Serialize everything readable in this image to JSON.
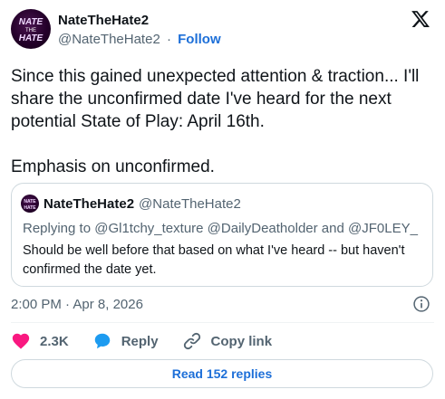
{
  "author": {
    "display_name": "NateTheHate2",
    "handle": "@NateTheHate2",
    "separator": "·",
    "follow_label": "Follow",
    "avatar_text": "NATE THE HATE"
  },
  "tweet": {
    "text": "Since this gained unexpected attention & traction... I'll share the unconfirmed date I've heard for the next potential State of Play: April 16th.\n\nEmphasis on unconfirmed."
  },
  "quote": {
    "display_name": "NateTheHate2",
    "handle": "@NateTheHate2",
    "replying_prefix": "Replying to",
    "mentions": [
      "@Gl1tchy_texture",
      "@DailyDeatholder",
      "@JF0LEY_"
    ],
    "and_word": "and",
    "body": "Should be well before that based on what I've heard -- but haven't confirmed the date yet."
  },
  "meta": {
    "time": "2:00 PM",
    "separator": "·",
    "date": "Apr 8, 2026"
  },
  "actions": {
    "like_count": "2.3K",
    "reply_label": "Reply",
    "copy_label": "Copy link"
  },
  "read_replies_label": "Read 152 replies",
  "colors": {
    "like": "#f91880",
    "reply": "#1d9bf0",
    "link": "#1d6fd8",
    "muted": "#536471"
  },
  "icons": [
    "x-logo-icon",
    "info-icon",
    "heart-icon",
    "reply-bubble-icon",
    "link-icon"
  ]
}
